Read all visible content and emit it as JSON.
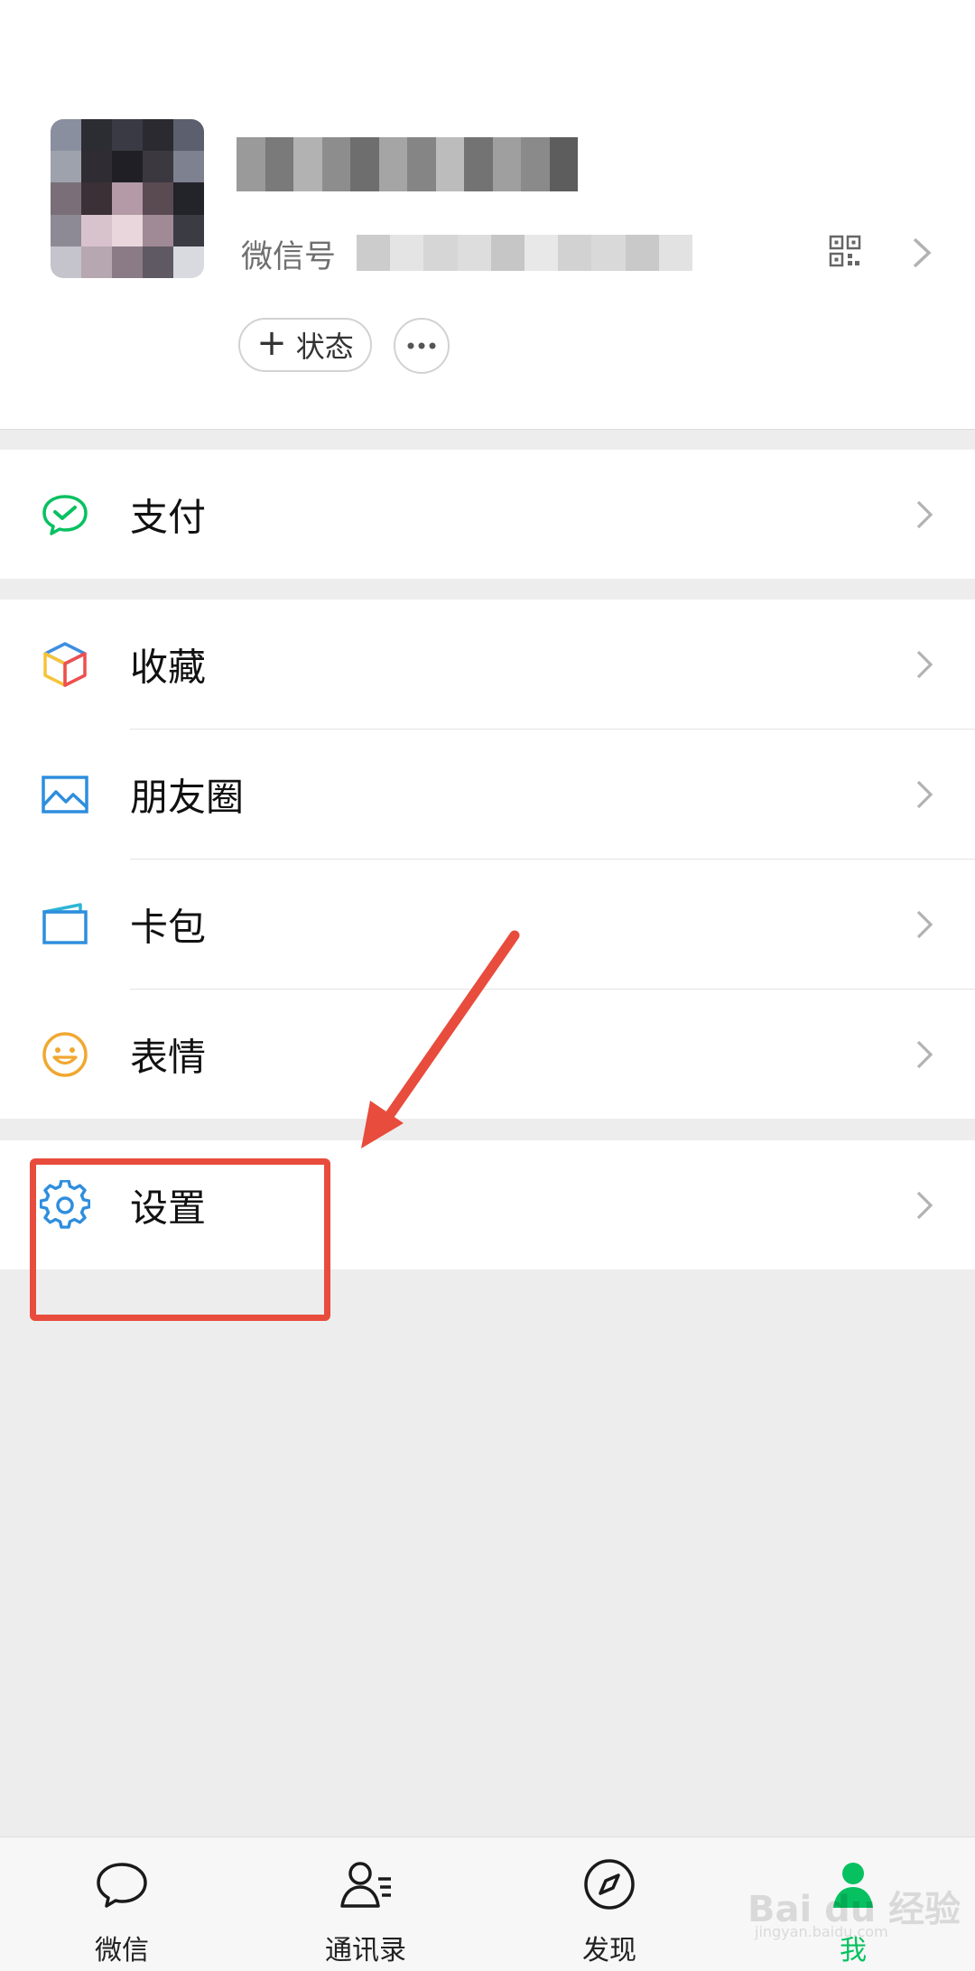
{
  "profile": {
    "wechat_id_label": "微信号",
    "status_button_label": "状态",
    "avatar_colors": [
      "#8a8f9f",
      "#2c2c33",
      "#3a3a44",
      "#2a2a30",
      "#5b5f6e",
      "#9ea2ad",
      "#2f2c33",
      "#1f1f25",
      "#3b3840",
      "#7d8190",
      "#7a6f78",
      "#3a3035",
      "#b39aa6",
      "#5a4a52",
      "#23232a",
      "#8e8a95",
      "#d8c3cc",
      "#e8d6dc",
      "#a08a96",
      "#3b3b44",
      "#c5c3cb",
      "#b6a7b0",
      "#8b7b86",
      "#5f5963",
      "#d9d9e0"
    ],
    "nickname_colors": [
      "#9a9a9a",
      "#7a7a7a",
      "#b2b2b2",
      "#8d8d8d",
      "#6e6e6e",
      "#a5a5a5",
      "#858585",
      "#bcbcbc",
      "#737373",
      "#9f9f9f",
      "#8a8a8a",
      "#5d5d5d"
    ],
    "wxid_colors": [
      "#c4c4c4",
      "#e0e0e0",
      "#cfcfcf",
      "#d8d8d8",
      "#bdbdbd",
      "#e5e5e5",
      "#cbcbcb",
      "#d3d3d3",
      "#c0c0c0",
      "#dedede"
    ]
  },
  "menu": {
    "pay": "支付",
    "favorites": "收藏",
    "moments": "朋友圈",
    "cards": "卡包",
    "stickers": "表情",
    "settings": "设置"
  },
  "icons": {
    "pay": "wechat-pay-icon",
    "favorites": "cube-icon",
    "moments": "picture-icon",
    "cards": "card-icon",
    "stickers": "smile-icon",
    "settings": "gear-icon"
  },
  "tabs": [
    {
      "label": "微信",
      "icon": "chat-bubble-icon"
    },
    {
      "label": "通讯录",
      "icon": "contacts-icon"
    },
    {
      "label": "发现",
      "icon": "compass-icon"
    },
    {
      "label": "我",
      "icon": "person-icon",
      "active": true
    }
  ],
  "colors": {
    "accent": "#07c160",
    "annotation": "#e84c3d"
  },
  "watermark": {
    "text": "Bai du 经验",
    "sub": "jingyan.baidu.com"
  }
}
